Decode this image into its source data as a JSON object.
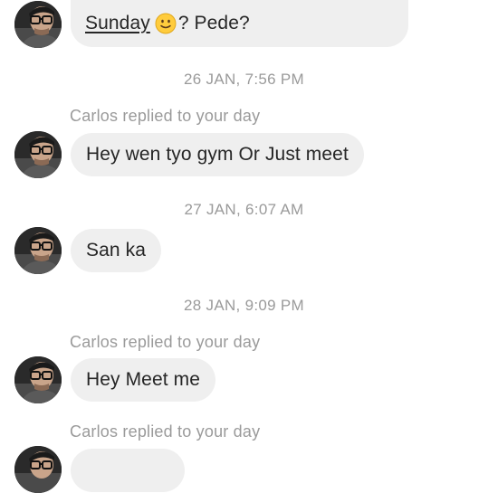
{
  "conversation": {
    "contact_name": "Carlos",
    "messages": [
      {
        "text_link": "Sunday",
        "emoji": "slightly-smiling-face",
        "text_after": "? Pede?"
      },
      {
        "text": "Hey wen tyo gym Or Just meet"
      },
      {
        "text": "San ka"
      },
      {
        "text": "Hey Meet me"
      },
      {
        "text": ""
      }
    ],
    "timestamps": [
      "26 JAN, 7:56 PM",
      "27 JAN, 6:07 AM",
      "28 JAN, 9:09 PM"
    ],
    "reply_notes": [
      "Carlos replied to your day",
      "Carlos replied to your day",
      "Carlos replied to your day"
    ]
  },
  "colors": {
    "bubble_background": "#efefef",
    "message_text": "#262626",
    "meta_text": "#9a9a9a",
    "background": "#ffffff"
  }
}
